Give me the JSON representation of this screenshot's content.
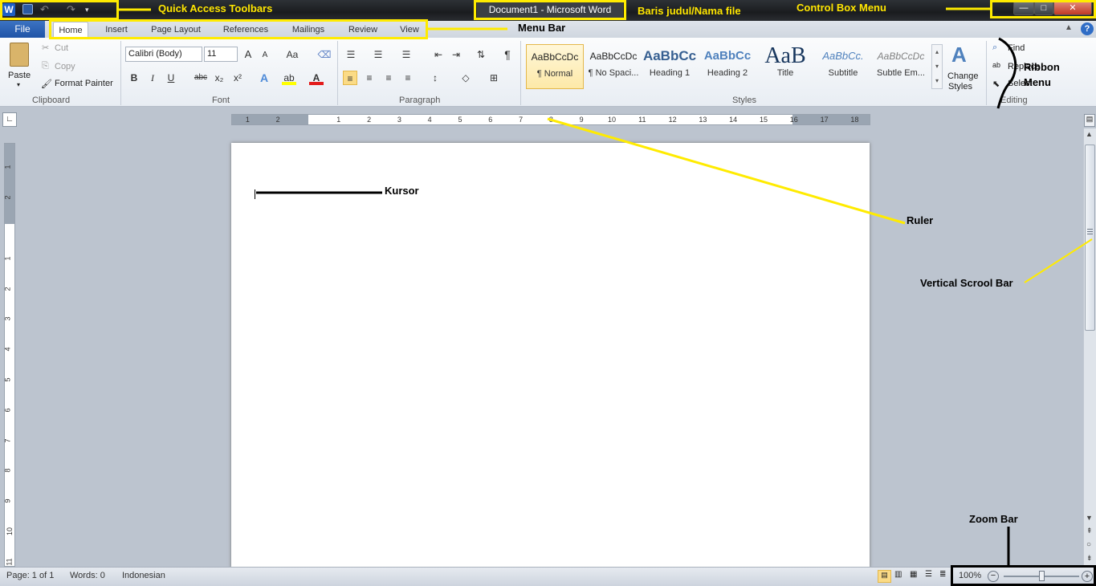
{
  "window": {
    "title": "Document1  -  Microsoft Word",
    "app_icon": "W"
  },
  "quick_access": [
    "save-icon",
    "undo-icon",
    "redo-icon",
    "customize-icon"
  ],
  "control_box": {
    "minimize": "—",
    "maximize": "□",
    "close": "✕"
  },
  "tabs": {
    "file": "File",
    "items": [
      "Home",
      "Insert",
      "Page Layout",
      "References",
      "Mailings",
      "Review",
      "View"
    ],
    "active": "Home"
  },
  "ribbon": {
    "clipboard": {
      "paste": "Paste",
      "cut": "Cut",
      "copy": "Copy",
      "format_painter": "Format Painter",
      "label": "Clipboard"
    },
    "font": {
      "name": "Calibri (Body)",
      "size": "11",
      "label": "Font",
      "bold": "B",
      "italic": "I",
      "underline": "U",
      "strike": "abc",
      "sub": "x₂",
      "sup": "x²",
      "grow": "A",
      "shrink": "A",
      "case": "Aa"
    },
    "paragraph": {
      "label": "Paragraph",
      "pilcrow": "¶"
    },
    "styles": {
      "label": "Styles",
      "tiles": [
        {
          "preview": "AaBbCcDc",
          "name": "¶ Normal"
        },
        {
          "preview": "AaBbCcDc",
          "name": "¶ No Spaci..."
        },
        {
          "preview": "AaBbCc",
          "name": "Heading 1"
        },
        {
          "preview": "AaBbCc",
          "name": "Heading 2"
        },
        {
          "preview": "AaB",
          "name": "Title"
        },
        {
          "preview": "AaBbCc.",
          "name": "Subtitle"
        },
        {
          "preview": "AaBbCcDc",
          "name": "Subtle Em..."
        }
      ],
      "change_styles_1": "Change",
      "change_styles_2": "Styles"
    },
    "editing": {
      "find": "Find",
      "replace": "Replace",
      "select": "Select",
      "label": "Editing"
    }
  },
  "ruler": {
    "left": [
      "2",
      "1"
    ],
    "right": [
      "1",
      "2",
      "3",
      "4",
      "5",
      "6",
      "7",
      "8",
      "9",
      "10",
      "11",
      "12",
      "13",
      "14",
      "15",
      "16",
      "17",
      "18"
    ]
  },
  "vruler": {
    "top": [
      "2",
      "1"
    ],
    "body": [
      "1",
      "2",
      "3",
      "4",
      "5",
      "6",
      "7",
      "8",
      "9",
      "10",
      "11"
    ]
  },
  "status": {
    "page": "Page: 1 of 1",
    "words": "Words: 0",
    "language": "Indonesian",
    "zoom": "100%",
    "zoom_fraction": 0.5
  },
  "annotations": {
    "quick_access": "Quick Access Toolbars",
    "title": "Baris judul/Nama file",
    "control_box": "Control Box Menu",
    "menu_bar": "Menu Bar",
    "ribbon_1": "Ribbon",
    "ribbon_2": "Menu",
    "cursor": "Kursor",
    "ruler": "Ruler",
    "vscroll": "Vertical Scrool Bar",
    "zoom": "Zoom Bar"
  },
  "colors": {
    "annotation_yellow": "#ffeb00",
    "file_tab": "#2a5fb0",
    "titlebar": "#1f2226"
  }
}
